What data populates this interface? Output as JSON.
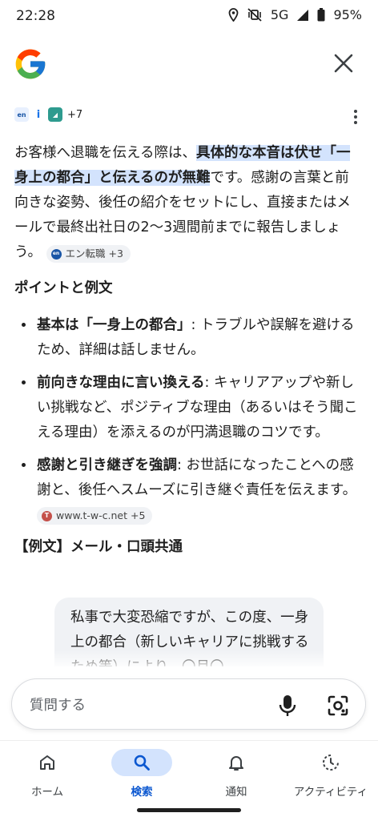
{
  "status_bar": {
    "time": "22:28",
    "network": "5G",
    "battery": "95%"
  },
  "header": {
    "logo": "google-logo",
    "close_icon": "close-icon"
  },
  "sources": {
    "more_count": "+7"
  },
  "answer": {
    "intro_part1": "お客様へ退職を伝える際は、",
    "intro_highlight": "具体的な本音は伏せ「一身上の都合」と伝えるのが無難",
    "intro_part2": "です。感謝の言葉と前向きな姿勢、後任の紹介をセットにし、直接またはメールで最終出社日の2〜3週間前までに報告しましょう。",
    "intro_chip": "エン転職 +3",
    "section_title": "ポイントと例文",
    "points": [
      {
        "bold": "基本は「一身上の都合」",
        "text": ": トラブルや誤解を避けるため、詳細は話しません。"
      },
      {
        "bold": "前向きな理由に言い換える",
        "text": ": キャリアアップや新しい挑戦など、ポジティブな理由（あるいはそう聞こえる理由）を添えるのが円満退職のコツです。"
      },
      {
        "bold": "感謝と引き継ぎを強調",
        "text": ": お世話になったことへの感謝と、後任へスムーズに引き継ぐ責任を伝えます。",
        "chip": "www.t-w-c.net +5",
        "chip_letter": "T"
      }
    ],
    "example_title": "【例文】メール・口頭共通",
    "example_text": "私事で大変恐縮ですが、この度、一身上の都合（新しいキャリアに挑戦するため等）により、〇月〇"
  },
  "search": {
    "placeholder": "質問する"
  },
  "bottom_nav": [
    {
      "label": "ホーム",
      "icon": "home-icon",
      "active": false
    },
    {
      "label": "検索",
      "icon": "search-icon",
      "active": true
    },
    {
      "label": "通知",
      "icon": "bell-icon",
      "active": false
    },
    {
      "label": "アクティビティ",
      "icon": "activity-icon",
      "active": false
    }
  ],
  "colors": {
    "accent": "#0b57d0",
    "highlight": "#d3e3fd",
    "chip_bg": "#f0f2f5"
  }
}
